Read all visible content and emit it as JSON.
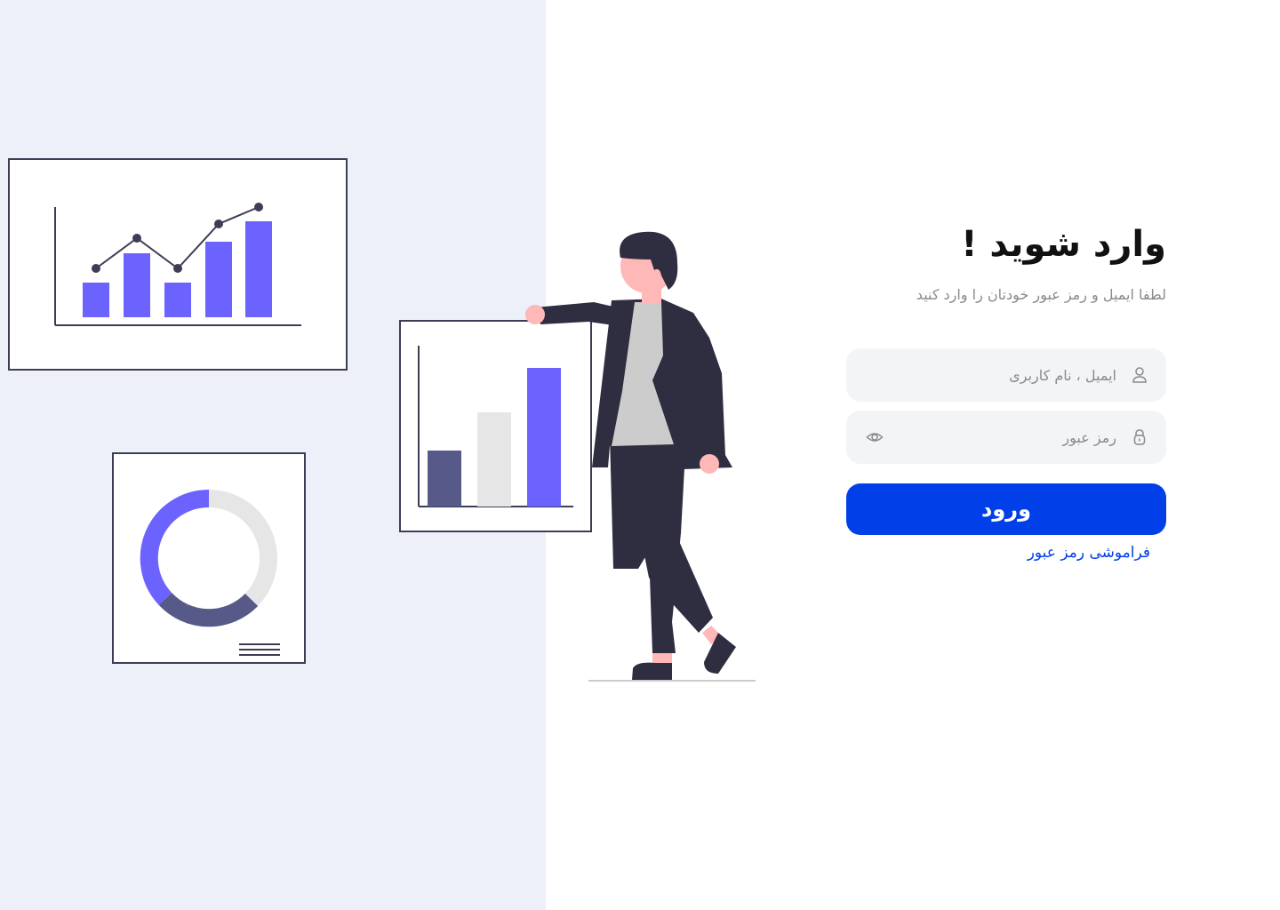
{
  "login": {
    "title": "وارد شوید !",
    "subtitle": "لطفا ایمیل و رمز عبور خودتان را وارد کنید",
    "username_placeholder": "ایمیل ، نام کاربری",
    "password_placeholder": "رمز عبور",
    "submit_label": "ورود",
    "forgot_label": "فراموشی رمز عبور"
  },
  "icons": {
    "username": "user-icon",
    "password": "lock-icon",
    "toggle": "eye-icon"
  },
  "colors": {
    "accent": "#0140e8",
    "panel_bg": "#edf0f9",
    "chart_purple": "#6c63ff",
    "chart_dark": "#575a89",
    "chart_gray": "#e6e6e6",
    "figure_dark": "#2f2e41"
  }
}
